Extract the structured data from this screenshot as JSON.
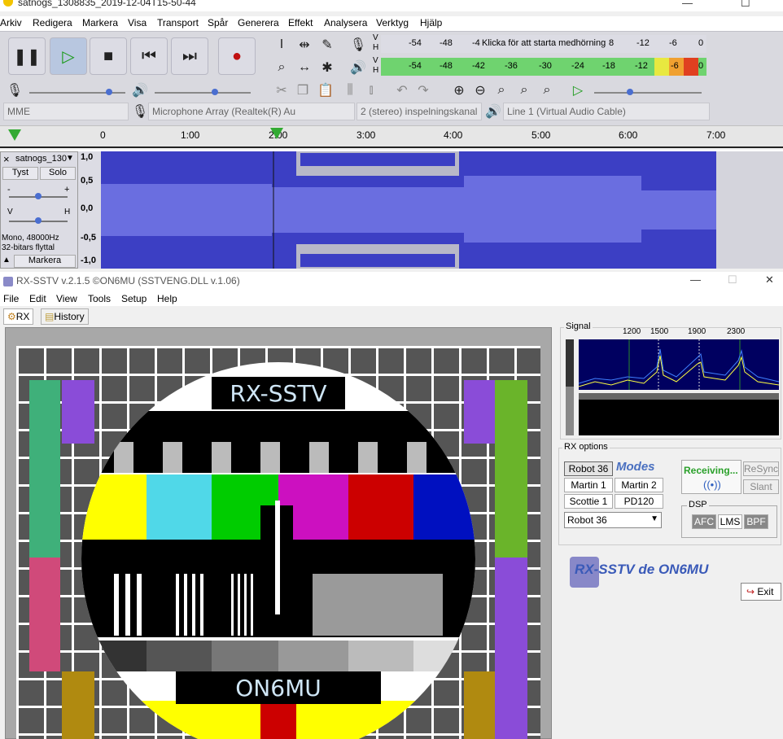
{
  "audacity": {
    "title": "satnogs_1308835_2019-12-04T15-50-44",
    "menu": [
      "Arkiv",
      "Redigera",
      "Markera",
      "Visa",
      "Transport",
      "Spår",
      "Generera",
      "Effekt",
      "Analysera",
      "Verktyg",
      "Hjälp"
    ],
    "meter_record": {
      "label_v": "V",
      "label_h": "H",
      "ticks": [
        "-54",
        "-48",
        "-4"
      ],
      "hint": "Klicka för att starta medhörning",
      "ticks_right": [
        "8",
        "-12",
        "-6",
        "0"
      ]
    },
    "meter_play": {
      "label_v": "V",
      "label_h": "H",
      "ticks": [
        "-54",
        "-48",
        "-42",
        "-36",
        "-30",
        "-24",
        "-18",
        "-12",
        "-6",
        "0"
      ]
    },
    "devices": {
      "host": "MME",
      "input": "Microphone Array (Realtek(R) Au",
      "channels": "2 (stereo) inspelningskanal",
      "output": "Line 1 (Virtual Audio Cable)"
    },
    "ruler": [
      "0",
      "1:00",
      "2:00",
      "3:00",
      "4:00",
      "5:00",
      "6:00",
      "7:00"
    ],
    "track": {
      "name": "satnogs_130",
      "mute": "Tyst",
      "solo": "Solo",
      "gain_minus": "-",
      "gain_plus": "+",
      "pan_left": "V",
      "pan_right": "H",
      "info1": "Mono, 48000Hz",
      "info2": "32-bitars flyttal",
      "select": "Markera",
      "close": "×",
      "scale": [
        "1,0",
        "0,5",
        "0,0",
        "-0,5",
        "-1,0"
      ]
    }
  },
  "rxsstv": {
    "title": "RX-SSTV v.2.1.5 ©ON6MU (SSTVENG.DLL v.1.06)",
    "menu": [
      "File",
      "Edit",
      "View",
      "Tools",
      "Setup",
      "Help"
    ],
    "tabs": [
      "RX",
      "History"
    ],
    "image": {
      "top_text": "RX-SSTV",
      "bottom_text": "ON6MU"
    },
    "signal": {
      "label": "Signal",
      "freqs": [
        "1200",
        "1500",
        "1900",
        "2300"
      ]
    },
    "rx_options": {
      "label": "RX options",
      "modes": [
        "Robot 36",
        "Martin 1",
        "Martin 2",
        "Scottie 1",
        "PD120"
      ],
      "selected_mode": "Robot 36",
      "modes_logo": "Modes",
      "status": "Receiving...",
      "resync": "ReSync",
      "slant": "Slant",
      "dsp_label": "DSP",
      "dsp": [
        "AFC",
        "LMS",
        "BPF"
      ]
    },
    "logo": "RX-SSTV de ON6MU",
    "exit": "Exit"
  },
  "colors": {
    "wave": "#3c3fc4",
    "wave_light": "#6a6ee0",
    "meter_green": "#6fd36f"
  }
}
